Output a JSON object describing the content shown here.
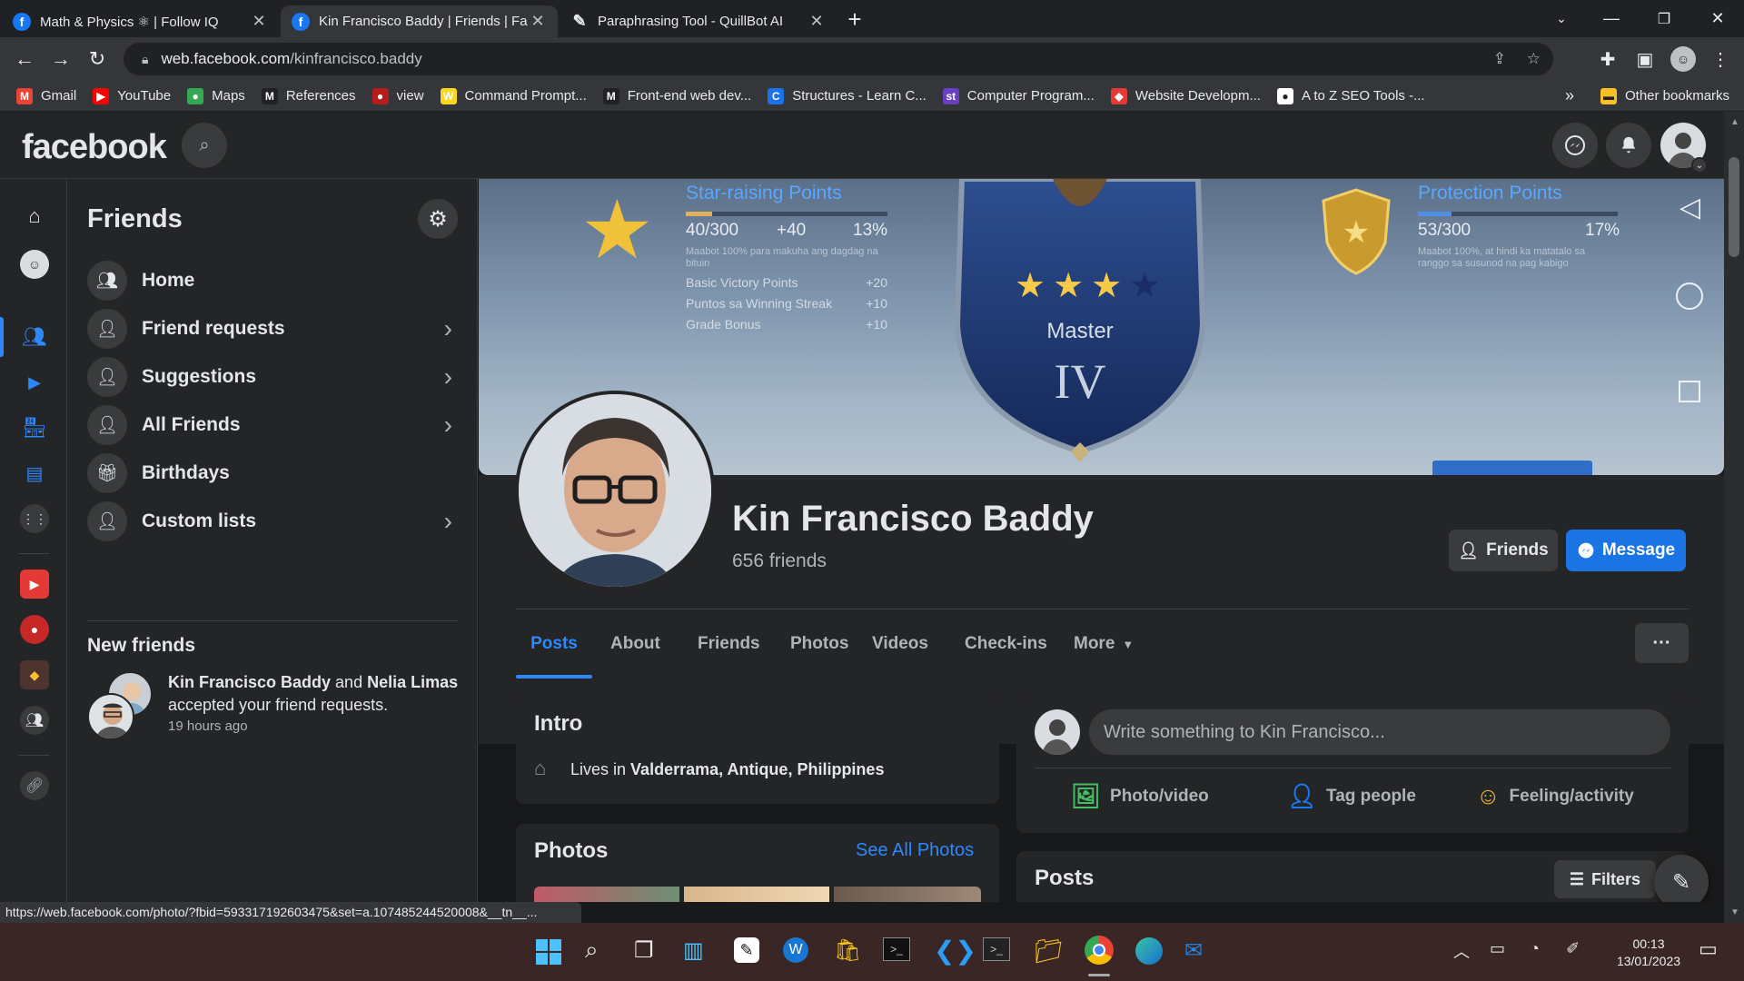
{
  "browser": {
    "tabs": [
      {
        "title": "Math & Physics ⚛ | Follow IQ",
        "favicon_color": "#1877f2"
      },
      {
        "title": "Kin Francisco Baddy | Friends | Fa",
        "favicon_color": "#1877f2"
      },
      {
        "title": "Paraphrasing Tool - QuillBot AI",
        "favicon_color": "#202124"
      }
    ],
    "url_host": "web.facebook.com",
    "url_path": "/kinfrancisco.baddy",
    "bookmarks": [
      {
        "label": "Gmail",
        "color": "#ea4335",
        "glyph": "M"
      },
      {
        "label": "YouTube",
        "color": "#ff0000",
        "glyph": "▶"
      },
      {
        "label": "Maps",
        "color": "#34a853",
        "glyph": "●"
      },
      {
        "label": "References",
        "color": "#202124",
        "glyph": "M"
      },
      {
        "label": "view",
        "color": "#b71c1c",
        "glyph": "●"
      },
      {
        "label": "Command Prompt...",
        "color": "#f9d71c",
        "glyph": "W"
      },
      {
        "label": "Front-end web dev...",
        "color": "#202124",
        "glyph": "M"
      },
      {
        "label": "Structures - Learn C...",
        "color": "#1a73e8",
        "glyph": "C"
      },
      {
        "label": "Computer Program...",
        "color": "#6a3fc4",
        "glyph": "st"
      },
      {
        "label": "Website Developm...",
        "color": "#e53935",
        "glyph": "◆"
      },
      {
        "label": "A to Z SEO Tools -...",
        "color": "#ffffff",
        "glyph": "●"
      }
    ],
    "overflow": "»",
    "other_bookmarks": "Other bookmarks",
    "status_url": "https://web.facebook.com/photo/?fbid=593317192603475&set=a.107485244520008&__tn__..."
  },
  "fb": {
    "logo": "facebook",
    "sidebar": {
      "title": "Friends",
      "items": [
        {
          "label": "Home",
          "icon": "friends-icon",
          "chevron": false
        },
        {
          "label": "Friend requests",
          "icon": "friend-request-icon",
          "chevron": true
        },
        {
          "label": "Suggestions",
          "icon": "add-friend-icon",
          "chevron": true
        },
        {
          "label": "All Friends",
          "icon": "friend-list-icon",
          "chevron": true
        },
        {
          "label": "Birthdays",
          "icon": "gift-icon",
          "chevron": false
        },
        {
          "label": "Custom lists",
          "icon": "custom-list-icon",
          "chevron": true
        }
      ],
      "new_friends_title": "New friends",
      "notif": {
        "name1": "Kin Francisco Baddy",
        "and": " and ",
        "name2": "Nelia Limas",
        "text": "accepted your friend requests.",
        "time": "19 hours ago"
      }
    },
    "cover": {
      "left_title": "Star-raising Points",
      "left_value": "40/300",
      "left_plus": "+40",
      "left_pct": "13%",
      "left_sub": "Maabot 100% para makuha ang dagdag na bituin",
      "rows": [
        {
          "label": "Basic Victory Points",
          "val": "+20"
        },
        {
          "label": "Puntos sa Winning Streak",
          "val": "+10"
        },
        {
          "label": "Grade Bonus",
          "val": "+10"
        }
      ],
      "rank": "Master",
      "rank_num": "IV",
      "right_title": "Protection Points",
      "right_value": "53/300",
      "right_pct": "17%",
      "right_sub": "Maabot 100%, at hindi ka  matatalo sa ranggo sa susunod na pag kabigo"
    },
    "profile": {
      "name": "Kin Francisco Baddy",
      "friends_count": "656 friends",
      "friends_btn": "Friends",
      "message_btn": "Message",
      "tabs": [
        "Posts",
        "About",
        "Friends",
        "Photos",
        "Videos",
        "Check-ins",
        "More"
      ],
      "more_dots": "···"
    },
    "intro": {
      "title": "Intro",
      "lives_prefix": "Lives in ",
      "lives_place": "Valderrama, Antique, Philippines"
    },
    "photos": {
      "title": "Photos",
      "see_all": "See All Photos"
    },
    "composer": {
      "placeholder": "Write something to Kin Francisco...",
      "actions": [
        "Photo/video",
        "Tag people",
        "Feeling/activity"
      ]
    },
    "posts": {
      "title": "Posts",
      "filters": "Filters"
    }
  },
  "taskbar": {
    "time": "00:13",
    "date": "13/01/2023"
  },
  "colors": {
    "accent": "#2d88ff",
    "message_btn": "#1b74e4"
  }
}
